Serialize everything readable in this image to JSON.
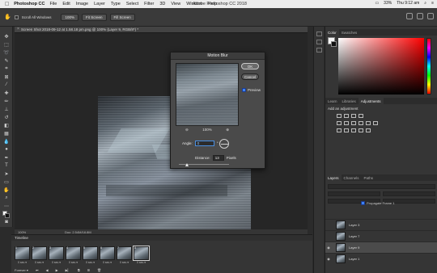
{
  "menubar": {
    "app": "Photoshop CC",
    "items": [
      "File",
      "Edit",
      "Image",
      "Layer",
      "Type",
      "Select",
      "Filter",
      "3D",
      "View",
      "Window",
      "Help"
    ],
    "window_title": "Adobe Photoshop CC 2018",
    "battery": "33%",
    "clock": "Thu 9:12 am"
  },
  "options_bar": {
    "scroll_all_windows": "Scroll All Windows",
    "zoom_value": "100%",
    "fit_screen": "Fit Screen",
    "fill_screen": "Fill Screen"
  },
  "document": {
    "tab_title": "Screen Shot 2018-09-12 at 1.58.18 pm.png @ 100% (Layer 9, RGB/8*) *",
    "status_zoom": "100%",
    "status_doc": "Doc: 2.54M/18.8M"
  },
  "timeline": {
    "title": "Timeline",
    "frames": [
      {
        "num": "1",
        "dur": "0 sec.▾"
      },
      {
        "num": "2",
        "dur": "0 sec.▾"
      },
      {
        "num": "3",
        "dur": "0 sec.▾"
      },
      {
        "num": "4",
        "dur": "0 sec.▾"
      },
      {
        "num": "5",
        "dur": "0 sec.▾"
      },
      {
        "num": "6",
        "dur": "0 sec.▾"
      },
      {
        "num": "7",
        "dur": "0 sec.▾"
      },
      {
        "num": "8",
        "dur": "0 sec.▾"
      }
    ],
    "loop": "Forever ▾"
  },
  "panels": {
    "color_tabs": [
      "Color",
      "Swatches"
    ],
    "adjust_tabs": [
      "Learn",
      "Libraries",
      "Adjustments"
    ],
    "adjust_title": "Add an adjustment",
    "layer_tabs": [
      "Layers",
      "Channels",
      "Paths"
    ],
    "propagate": "Propagate Frame 1",
    "layers": [
      "Layer 3",
      "Layer 7",
      "Layer 9",
      "Layer 1"
    ]
  },
  "dialog": {
    "title": "Motion Blur",
    "ok": "OK",
    "cancel": "Cancel",
    "preview": "Preview",
    "zoom": "100%",
    "zoom_out": "⊖",
    "zoom_in": "⊕",
    "angle_label": "Angle:",
    "angle_value": "0",
    "angle_unit": "°",
    "distance_label": "Distance:",
    "distance_value": "13",
    "distance_unit": "Pixels"
  },
  "colors": {
    "accent": "#4a90e2",
    "foreground": "#f5f5f5",
    "background": "#111111"
  }
}
